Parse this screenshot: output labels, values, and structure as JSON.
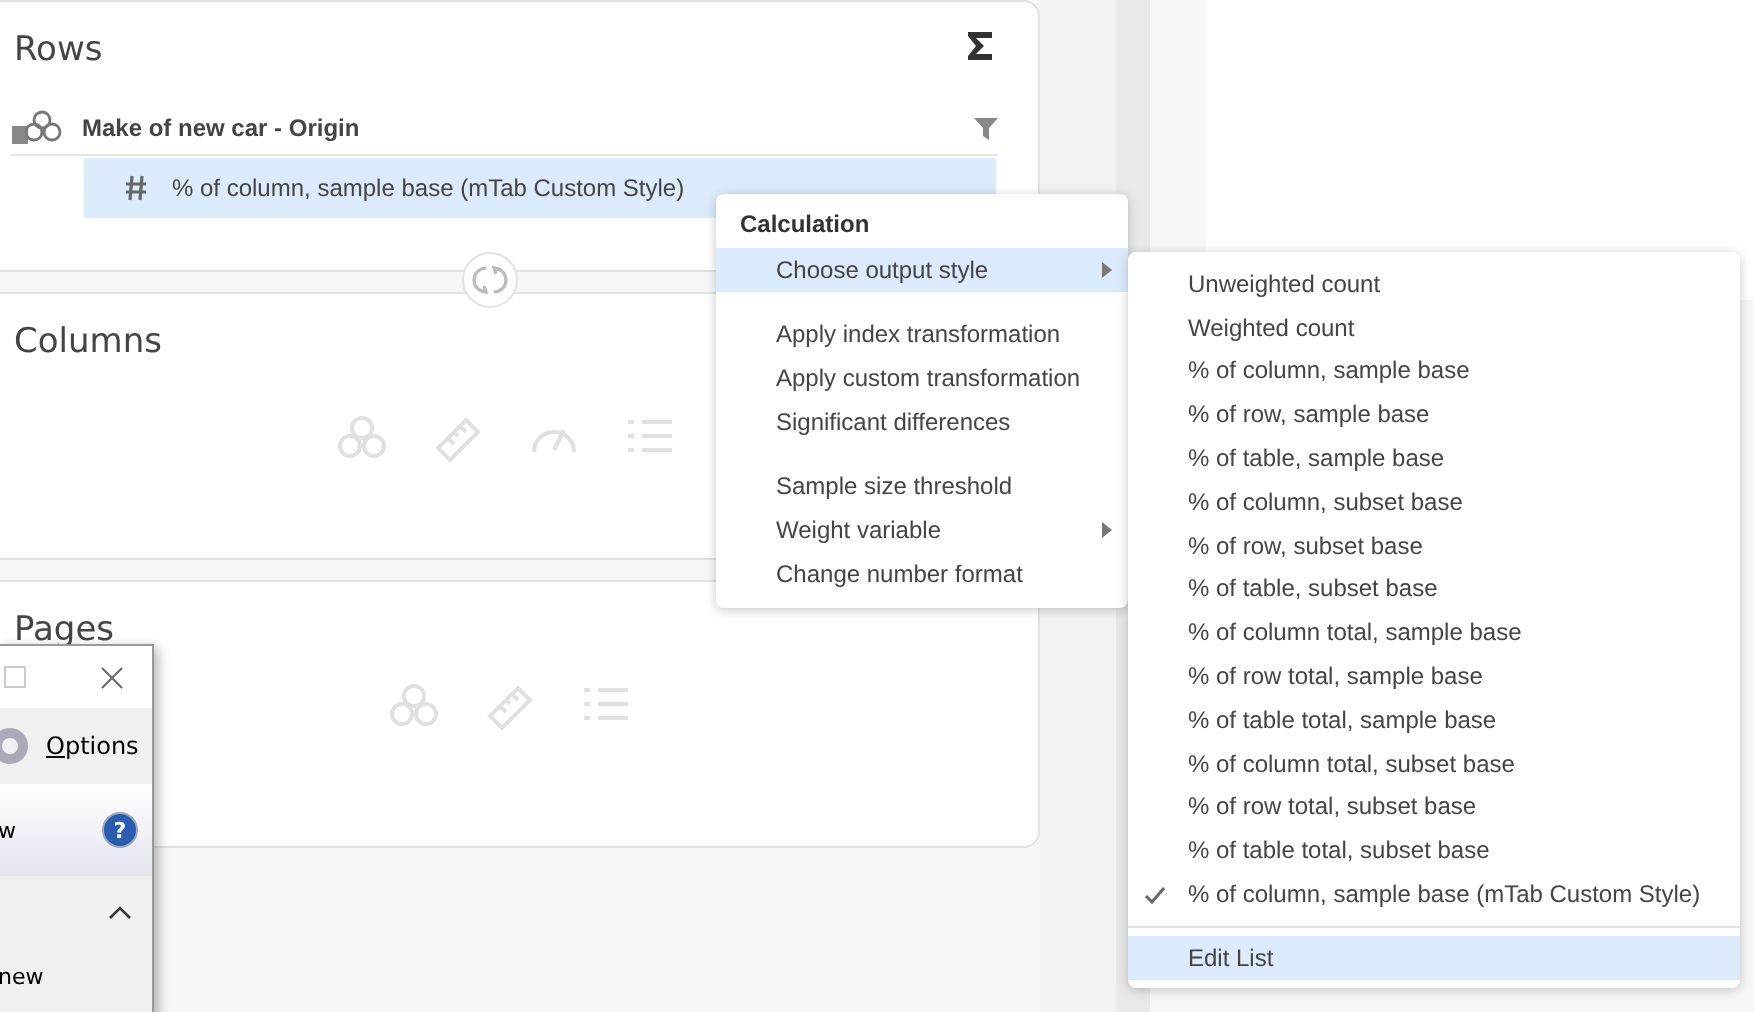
{
  "rows_panel": {
    "title": "Rows",
    "variable": {
      "name": "Make of new car - Origin"
    },
    "items": [
      {
        "label": "% of column, sample base (mTab Custom Style)",
        "selected": true
      }
    ]
  },
  "columns_panel": {
    "title": "Columns"
  },
  "pages_panel": {
    "title": "Pages"
  },
  "dialog": {
    "toolbar_label": "Options",
    "help_glyph": "?",
    "header_text": "w",
    "body_lines": [
      "new"
    ]
  },
  "context_menu": {
    "header": "Calculation",
    "groups": [
      [
        {
          "label": "Choose output style",
          "submenu": true,
          "selected": true
        }
      ],
      [
        {
          "label": "Apply index transformation",
          "submenu": false,
          "selected": false
        },
        {
          "label": "Apply custom transformation",
          "submenu": false,
          "selected": false
        },
        {
          "label": "Significant differences",
          "submenu": false,
          "selected": false
        }
      ],
      [
        {
          "label": "Sample size threshold",
          "submenu": false,
          "selected": false
        },
        {
          "label": "Weight variable",
          "submenu": true,
          "selected": false
        },
        {
          "label": "Change number format",
          "submenu": false,
          "selected": false
        }
      ]
    ]
  },
  "output_style_menu": {
    "items": [
      {
        "label": "Unweighted count",
        "checked": false
      },
      {
        "label": "Weighted count",
        "checked": false
      },
      {
        "label": "% of column, sample base",
        "checked": false
      },
      {
        "label": "% of row, sample base",
        "checked": false
      },
      {
        "label": "% of table, sample base",
        "checked": false
      },
      {
        "label": "% of column, subset base",
        "checked": false
      },
      {
        "label": "% of row, subset base",
        "checked": false
      },
      {
        "label": "% of table, subset base",
        "checked": false
      },
      {
        "label": "% of column total, sample base",
        "checked": false
      },
      {
        "label": "% of row total, sample base",
        "checked": false
      },
      {
        "label": "% of table total, sample base",
        "checked": false
      },
      {
        "label": "% of column total, subset base",
        "checked": false
      },
      {
        "label": "% of row total, subset base",
        "checked": false
      },
      {
        "label": "% of table total, subset base",
        "checked": false
      },
      {
        "label": "% of column, sample base (mTab Custom Style)",
        "checked": true
      }
    ],
    "footer_items": [
      {
        "label": "Edit List",
        "selected": true
      }
    ]
  }
}
